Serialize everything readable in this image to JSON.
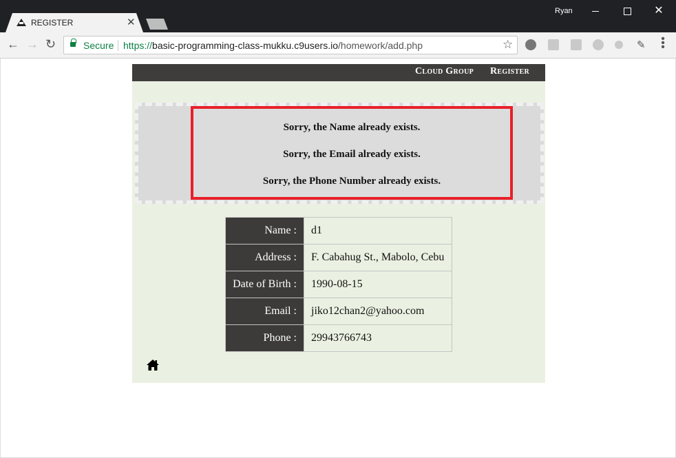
{
  "browser": {
    "tab_title": "REGISTER",
    "tab_close": "✕",
    "user_name": "Ryan",
    "secure_label": "Secure",
    "url_scheme": "https://",
    "url_host": "basic-programming-class-mukku.c9users.io",
    "url_path": "/homework/add.php",
    "icons": [
      "back-icon",
      "forward-icon",
      "reload-icon",
      "star-icon",
      "extension-icons",
      "menu-icon"
    ]
  },
  "nav": {
    "cloud_group": "Cloud Group",
    "register": "Register"
  },
  "alert": {
    "border_color": "#e8202a",
    "messages": [
      "Sorry, the Name already exists.",
      "Sorry, the Email already exists.",
      "Sorry, the Phone Number already exists."
    ]
  },
  "info_table": {
    "rows": [
      {
        "label": "Name :",
        "value": "d1"
      },
      {
        "label": "Address :",
        "value": "F. Cabahug St., Mabolo, Cebu"
      },
      {
        "label": "Date of Birth :",
        "value": "1990-08-15"
      },
      {
        "label": "Email :",
        "value": "jiko12chan2@yahoo.com"
      },
      {
        "label": "Phone :",
        "value": "29943766743"
      }
    ]
  },
  "colors": {
    "page_bg": "#ebf1e2",
    "header_bg": "#3e3d3c",
    "label_bg": "#3c3b3a"
  }
}
